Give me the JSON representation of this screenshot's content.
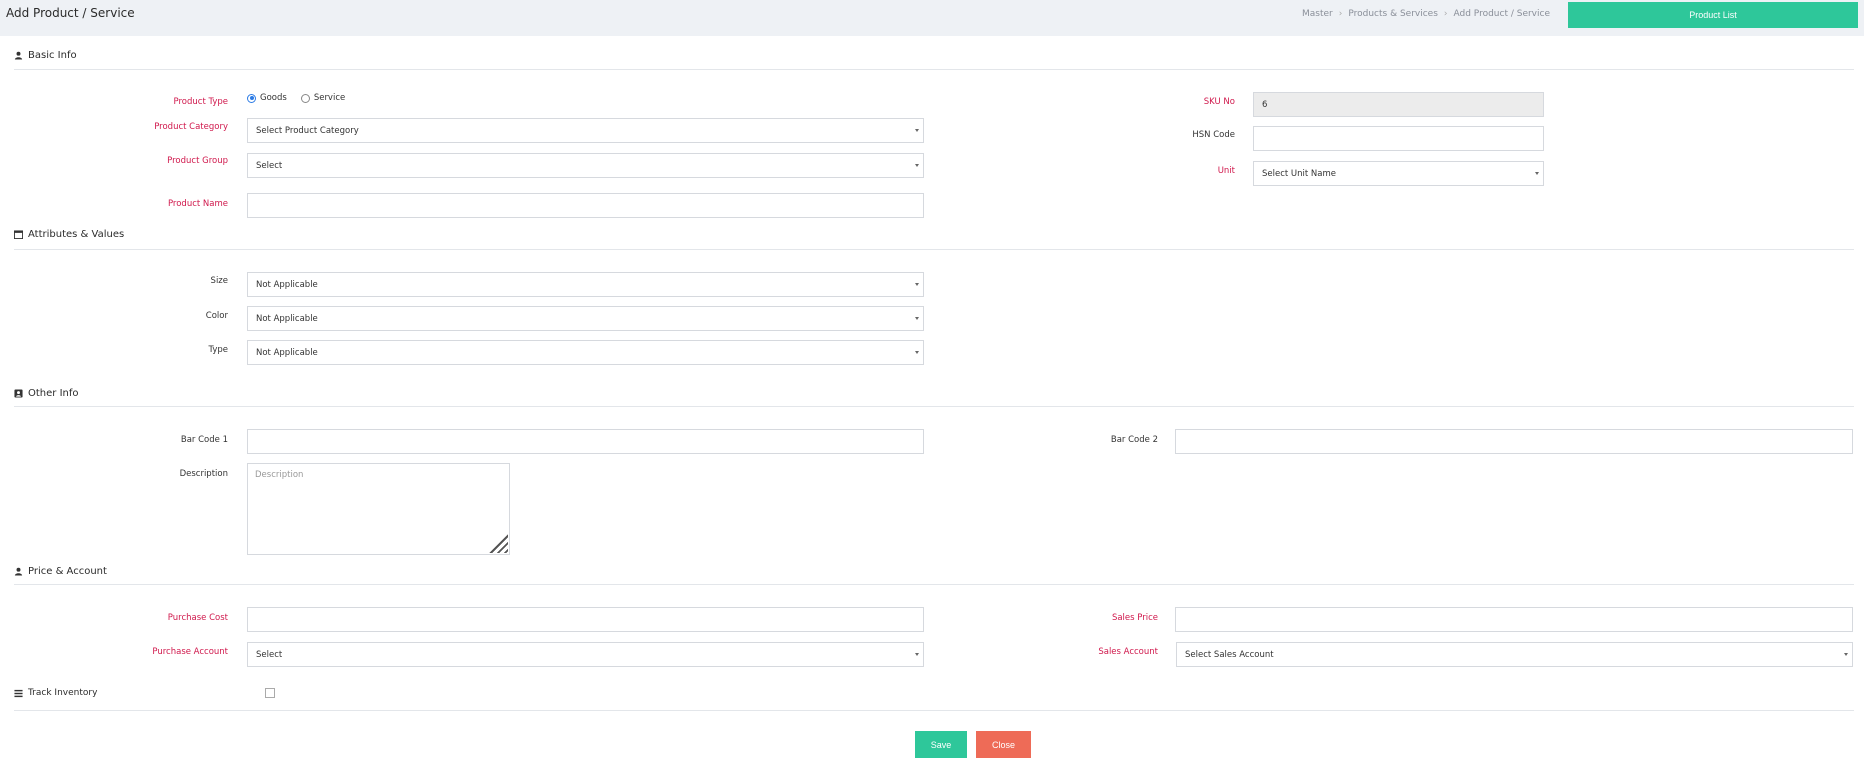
{
  "header": {
    "title": "Add Product / Service",
    "breadcrumb": [
      "Master",
      "Products & Services",
      "Add Product / Service"
    ],
    "product_list_button": "Product List"
  },
  "sections": {
    "basic_info": "Basic Info",
    "attributes": "Attributes & Values",
    "other_info": "Other Info",
    "price_account": "Price & Account"
  },
  "basic": {
    "product_type_label": "Product Type",
    "goods_label": "Goods",
    "service_label": "Service",
    "selected_type": "Goods",
    "product_category_label": "Product Category",
    "product_category_value": "Select Product Category",
    "product_group_label": "Product Group",
    "product_group_value": "Select",
    "product_name_label": "Product Name",
    "product_name_value": "",
    "sku_label": "SKU No",
    "sku_value": "6",
    "hsn_label": "HSN Code",
    "hsn_value": "",
    "unit_label": "Unit",
    "unit_value": "Select Unit Name"
  },
  "attributes": {
    "size_label": "Size",
    "size_value": "Not Applicable",
    "color_label": "Color",
    "color_value": "Not Applicable",
    "type_label": "Type",
    "type_value": "Not Applicable"
  },
  "other": {
    "barcode1_label": "Bar Code 1",
    "barcode1_value": "",
    "barcode2_label": "Bar Code 2",
    "barcode2_value": "",
    "description_label": "Description",
    "description_placeholder": "Description"
  },
  "price": {
    "purchase_cost_label": "Purchase Cost",
    "purchase_cost_value": "",
    "sales_price_label": "Sales Price",
    "sales_price_value": "",
    "purchase_account_label": "Purchase Account",
    "purchase_account_value": "Select",
    "sales_account_label": "Sales Account",
    "sales_account_value": "Select Sales Account"
  },
  "track_inventory": {
    "label": "Track Inventory",
    "checked": false
  },
  "actions": {
    "save": "Save",
    "close": "Close"
  },
  "colors": {
    "accent_green": "#2ec79a",
    "close_red": "#ee6b57",
    "required_label": "#d0184c",
    "radio_selected": "#2c7be5"
  }
}
